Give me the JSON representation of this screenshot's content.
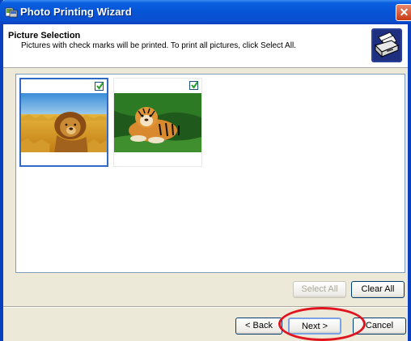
{
  "window": {
    "title": "Photo Printing Wizard",
    "close_label": "✕"
  },
  "header": {
    "title": "Picture Selection",
    "description": "Pictures with check marks will be printed.  To print all pictures, click Select All."
  },
  "pictures": [
    {
      "name": "lion",
      "checked": true,
      "selected": true
    },
    {
      "name": "tiger",
      "checked": true,
      "selected": false
    }
  ],
  "buttons": {
    "select_all": {
      "label": "Select All",
      "enabled": false
    },
    "clear_all": {
      "label": "Clear All",
      "enabled": true
    },
    "back": {
      "label": "< Back"
    },
    "next": {
      "label": "Next >"
    },
    "cancel": {
      "label": "Cancel"
    }
  },
  "colors": {
    "title_bar": "#0654d6",
    "highlight": "#e0141e",
    "selection_border": "#3169c6"
  }
}
